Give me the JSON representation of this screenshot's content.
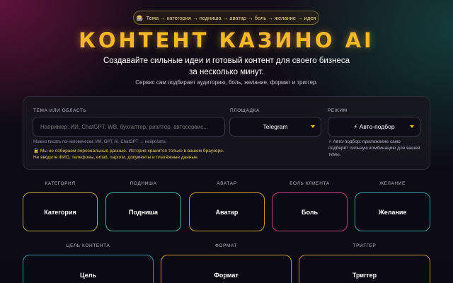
{
  "breadcrumb": {
    "icon": "slot-machine-icon",
    "text": "Тема → категория → подниша → аватар → боль → желание → идея"
  },
  "hero": {
    "title": "КОНТЕНТ КАЗИНО AI",
    "subtitle": "Создавайте сильные идеи и готовый контент для своего бизнеса за несколько минут.",
    "description": "Сервис сам подбирает аудиторию, боль, желание, формат и триггер."
  },
  "form": {
    "topic": {
      "label": "ТЕМА ИЛИ ОБЛАСТЬ",
      "placeholder": "Например: ИИ, ChatGPT, WB, бухгалтер, риэлтор, автосервис...",
      "hint": "Можно писать по-человечески: ИИ, GPT, AI, ChatGPT → нейросети."
    },
    "privacy": [
      "🔒 Мы не собираем персональные данные. История хранится только в вашем браузере.",
      "Не вводите ФИО, телефоны, email, пароли, документы и платёжные данные."
    ],
    "platform": {
      "label": "ПЛОЩАДКА",
      "value": "Telegram"
    },
    "mode": {
      "label": "РЕЖИМ",
      "value": "⚡ Авто-подбор",
      "hint": [
        "⚡ Авто-подбор: приложение само",
        "подберёт сильную комбинацию для вашей",
        "темы."
      ]
    }
  },
  "slots_row1": [
    {
      "label": "КАТЕГОРИЯ",
      "value": "Категория",
      "color": "#b9a33a"
    },
    {
      "label": "ПОДНИША",
      "value": "Подниша",
      "color": "#3fb09a"
    },
    {
      "label": "АВАТАР",
      "value": "Аватар",
      "color": "#d09a2a"
    },
    {
      "label": "БОЛЬ КЛИЕНТА",
      "value": "Боль",
      "color": "#c23a7a"
    },
    {
      "label": "ЖЕЛАНИЕ",
      "value": "Желание",
      "color": "#2f9aa8"
    }
  ],
  "slots_row2": [
    {
      "label": "ЦЕЛЬ КОНТЕНТА",
      "value": "Цель",
      "color": "#2f9aa8"
    },
    {
      "label": "ФОРМАТ",
      "value": "Формат",
      "color": "#d09a2a"
    },
    {
      "label": "ТРИГГЕР",
      "value": "Триггер",
      "color": "#d0902a"
    }
  ]
}
